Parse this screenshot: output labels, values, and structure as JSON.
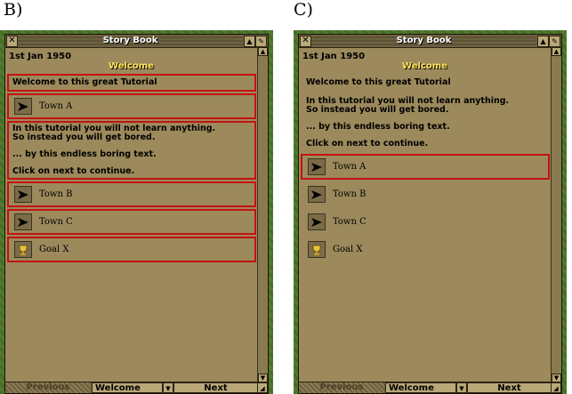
{
  "panels": [
    {
      "letter": "B)",
      "window_title": "Story Book",
      "date": "1st Jan 1950",
      "page_title": "Welcome",
      "heading": "Welcome to this great Tutorial",
      "town_a": "Town A",
      "text_lines": [
        "In this tutorial you will not learn anything.",
        "So instead you will get bored."
      ],
      "text_line3": "... by this endless boring text.",
      "text_line4": "Click on next to continue.",
      "items": [
        "Town B",
        "Town C",
        "Goal X"
      ],
      "footer": {
        "previous": "Previous",
        "selected": "Welcome",
        "next": "Next"
      }
    },
    {
      "letter": "C)",
      "window_title": "Story Book",
      "date": "1st Jan 1950",
      "page_title": "Welcome",
      "heading": "Welcome to this great Tutorial",
      "text_lines": [
        "In this tutorial you will not learn anything.",
        "So instead you will get bored."
      ],
      "text_line3": "... by this endless boring text.",
      "text_line4": "Click on next to continue.",
      "items": [
        "Town A",
        "Town B",
        "Town C",
        "Goal X"
      ],
      "footer": {
        "previous": "Previous",
        "selected": "Welcome",
        "next": "Next"
      }
    }
  ],
  "icons": {
    "close": "close-icon",
    "shade": "shade-icon",
    "pin": "pin-icon",
    "arrow": "arrow-icon",
    "goal": "trophy-icon"
  },
  "colors": {
    "highlight_border": "#c41212",
    "window_bg": "#9c8a5c",
    "title_yellow": "#ffe25a"
  }
}
